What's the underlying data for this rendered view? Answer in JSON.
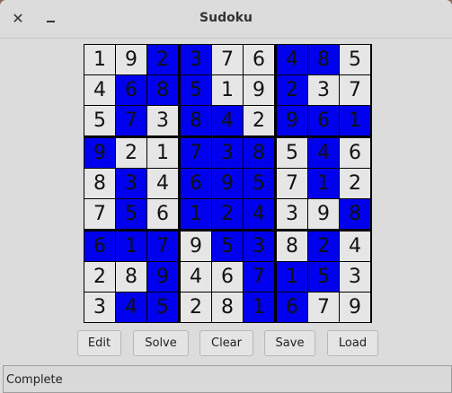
{
  "window": {
    "title": "Sudoku",
    "close_glyph": "✕"
  },
  "board": {
    "values": [
      [
        1,
        9,
        2,
        3,
        7,
        6,
        4,
        8,
        5
      ],
      [
        4,
        6,
        8,
        5,
        1,
        9,
        2,
        3,
        7
      ],
      [
        5,
        7,
        3,
        8,
        4,
        2,
        9,
        6,
        1
      ],
      [
        9,
        2,
        1,
        7,
        3,
        8,
        5,
        4,
        6
      ],
      [
        8,
        3,
        4,
        6,
        9,
        5,
        7,
        1,
        2
      ],
      [
        7,
        5,
        6,
        1,
        2,
        4,
        3,
        9,
        8
      ],
      [
        6,
        1,
        7,
        9,
        5,
        3,
        8,
        2,
        4
      ],
      [
        2,
        8,
        9,
        4,
        6,
        7,
        1,
        5,
        3
      ],
      [
        3,
        4,
        5,
        2,
        8,
        1,
        6,
        7,
        9
      ]
    ],
    "highlighted": [
      [
        0,
        0,
        1,
        1,
        0,
        0,
        1,
        1,
        0
      ],
      [
        0,
        1,
        1,
        1,
        0,
        0,
        1,
        0,
        0
      ],
      [
        0,
        1,
        0,
        1,
        1,
        0,
        1,
        1,
        1
      ],
      [
        1,
        0,
        0,
        1,
        1,
        1,
        0,
        1,
        0
      ],
      [
        0,
        1,
        0,
        1,
        1,
        1,
        0,
        1,
        0
      ],
      [
        0,
        1,
        0,
        1,
        1,
        1,
        0,
        0,
        1
      ],
      [
        1,
        1,
        1,
        0,
        1,
        1,
        0,
        1,
        0
      ],
      [
        0,
        0,
        1,
        0,
        0,
        1,
        1,
        1,
        0
      ],
      [
        0,
        1,
        1,
        0,
        0,
        1,
        1,
        0,
        0
      ]
    ],
    "colors": {
      "highlight": "#0000ee",
      "normal": "#e6e6e6"
    }
  },
  "buttons": {
    "edit": "Edit",
    "solve": "Solve",
    "clear": "Clear",
    "save": "Save",
    "load": "Load"
  },
  "status": {
    "text": "Complete"
  }
}
